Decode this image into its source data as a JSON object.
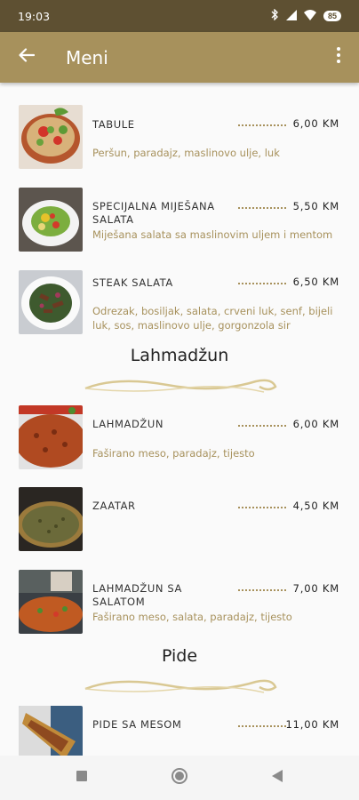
{
  "status_bar": {
    "time": "19:03",
    "battery": "85"
  },
  "app_bar": {
    "title": "Meni"
  },
  "sections": {
    "lahmadzun": {
      "title": "Lahmadžun"
    },
    "pide": {
      "title": "Pide"
    }
  },
  "items": [
    {
      "name": "TABULE",
      "price": "6,00 KM",
      "description": "Peršun, paradajz, maslinovo ulje, luk"
    },
    {
      "name": "SPECIJALNA MIJEŠANA SALATA",
      "price": "5,50 KM",
      "description": "Miješana salata sa maslinovim uljem i mentom"
    },
    {
      "name": "STEAK SALATA",
      "price": "6,50 KM",
      "description": "Odrezak, bosiljak, salata, crveni luk, senf, bijeli luk, sos, maslinovo ulje, gorgonzola sir"
    },
    {
      "name": "LAHMADŽUN",
      "price": "6,00 KM",
      "description": "Faširano meso, paradajz, tijesto"
    },
    {
      "name": "ZAATAR",
      "price": "4,50 KM",
      "description": ""
    },
    {
      "name": "LAHMADŽUN SA SALATOM",
      "price": "7,00 KM",
      "description": "Faširano meso, salata, paradajz, tijesto"
    },
    {
      "name": "PIDE SA MESOM",
      "price": "11,00 KM",
      "description": ""
    }
  ],
  "colors": {
    "accent": "#a7915c",
    "status_bar": "#5e5032",
    "background": "#fafafa"
  },
  "icons": {
    "back": "arrow-left-icon",
    "more": "more-vert-icon",
    "nav_recent": "square-icon",
    "nav_home": "circle-icon",
    "nav_back": "triangle-icon"
  }
}
